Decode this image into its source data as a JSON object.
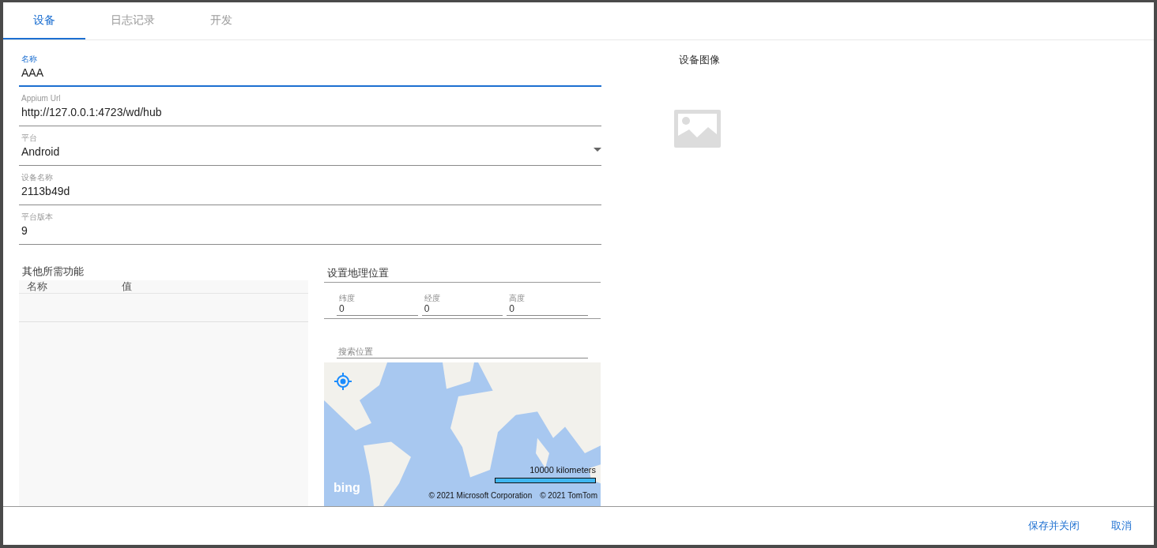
{
  "tabs": [
    {
      "label": "设备",
      "selected": true
    },
    {
      "label": "日志记录",
      "selected": false
    },
    {
      "label": "开发",
      "selected": false
    }
  ],
  "fields": [
    {
      "kind": "text",
      "label": "名称",
      "value": "AAA",
      "focused": true
    },
    {
      "kind": "text",
      "label": "Appium Url",
      "value": "http://127.0.0.1:4723/wd/hub",
      "focused": false
    },
    {
      "kind": "select",
      "label": "平台",
      "value": "Android",
      "focused": false
    },
    {
      "kind": "text",
      "label": "设备名称",
      "value": "2113b49d",
      "focused": false
    },
    {
      "kind": "text",
      "label": "平台版本",
      "value": "9",
      "focused": false
    }
  ],
  "capabilities": {
    "title": "其他所需功能",
    "columns": [
      "名称",
      "值"
    ]
  },
  "geolocation": {
    "title": "设置地理位置",
    "coords": [
      {
        "label": "纬度",
        "value": "0"
      },
      {
        "label": "经度",
        "value": "0"
      },
      {
        "label": "高度",
        "value": "0"
      }
    ],
    "search": {
      "placeholder": "搜索位置"
    },
    "map": {
      "kind": "picture",
      "scale": "10000 kilometers",
      "logo": "bing",
      "copyrights": [
        "© 2021 Microsoft Corporation",
        "© 2021 TomTom"
      ]
    }
  },
  "device_image": {
    "title": "设备图像"
  },
  "buttons": [
    "保存并关闭",
    "取消"
  ]
}
